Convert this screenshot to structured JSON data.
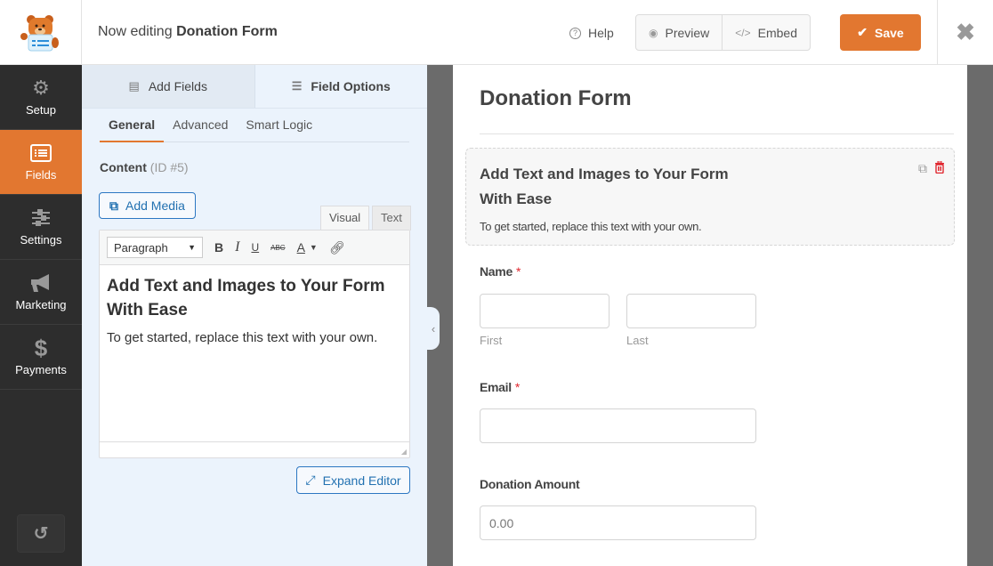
{
  "header": {
    "logo_alt": "WPForms bear mascot",
    "title_prefix": "Now editing",
    "form_name": "Donation Form",
    "help_label": "Help",
    "preview_label": "Preview",
    "embed_label": "Embed",
    "save_label": "Save",
    "accent_color": "#e27730"
  },
  "sidebar": {
    "items": [
      {
        "label": "Setup",
        "icon": "gear-icon"
      },
      {
        "label": "Fields",
        "icon": "fields-list-icon",
        "active": true
      },
      {
        "label": "Settings",
        "icon": "sliders-icon"
      },
      {
        "label": "Marketing",
        "icon": "megaphone-icon"
      },
      {
        "label": "Payments",
        "icon": "dollar-icon"
      }
    ],
    "history_icon": "revisions-history-icon"
  },
  "panel": {
    "tabs": [
      {
        "label": "Add Fields",
        "icon": "list-icon"
      },
      {
        "label": "Field Options",
        "icon": "sliders-icon",
        "active": true
      }
    ],
    "subtabs": [
      {
        "label": "General",
        "active": true
      },
      {
        "label": "Advanced"
      },
      {
        "label": "Smart Logic"
      }
    ],
    "content_label": "Content",
    "content_id": "(ID #5)",
    "add_media_label": "Add Media",
    "mode_visual": "Visual",
    "mode_text": "Text",
    "format_select_value": "Paragraph",
    "toolbar_bold": "B",
    "toolbar_italic": "I",
    "toolbar_underline": "U",
    "toolbar_strike": "ABC",
    "toolbar_color": "A",
    "editor_heading": "Add Text and Images to Your Form With Ease",
    "editor_paragraph": "To get started, replace this text with your own.",
    "expand_editor_label": "Expand Editor"
  },
  "preview": {
    "form_title": "Donation Form",
    "content_heading": "Add Text and Images to Your Form With Ease",
    "content_text": "To get started, replace this text with your own.",
    "fields": {
      "name_label": "Name",
      "name_required": "*",
      "first_sublabel": "First",
      "last_sublabel": "Last",
      "email_label": "Email",
      "email_required": "*",
      "donation_label": "Donation Amount",
      "donation_placeholder": "0.00"
    }
  }
}
